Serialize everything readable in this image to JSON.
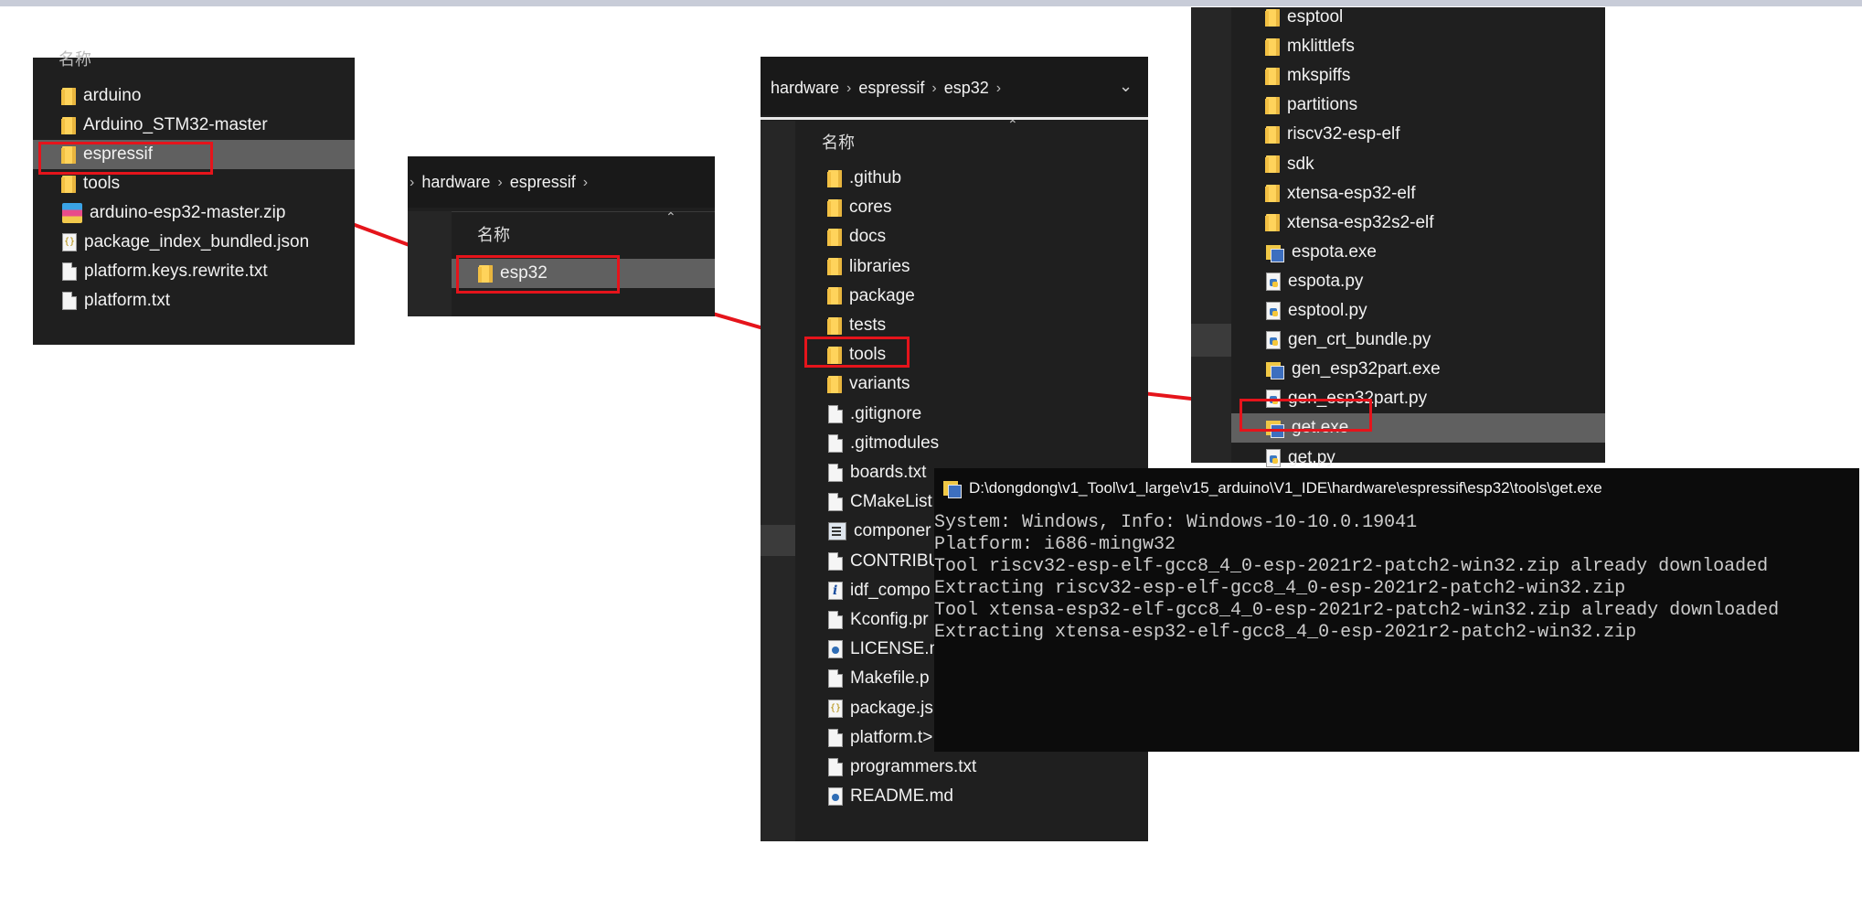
{
  "panel1": {
    "header": "名称",
    "items": [
      {
        "icon": "folder",
        "label": "arduino"
      },
      {
        "icon": "folder",
        "label": "Arduino_STM32-master"
      },
      {
        "icon": "folder",
        "label": "espressif"
      },
      {
        "icon": "folder",
        "label": "tools"
      },
      {
        "icon": "zip",
        "label": "arduino-esp32-master.zip"
      },
      {
        "icon": "json",
        "label": "package_index_bundled.json"
      },
      {
        "icon": "file",
        "label": "platform.keys.rewrite.txt"
      },
      {
        "icon": "file",
        "label": "platform.txt"
      }
    ]
  },
  "panel2": {
    "breadcrumb": [
      "hardware",
      "espressif"
    ],
    "header": "名称",
    "items": [
      {
        "icon": "folder",
        "label": "esp32"
      }
    ]
  },
  "panel3": {
    "breadcrumb": [
      "hardware",
      "espressif",
      "esp32"
    ],
    "header": "名称",
    "items": [
      {
        "icon": "folder",
        "label": ".github"
      },
      {
        "icon": "folder",
        "label": "cores"
      },
      {
        "icon": "folder",
        "label": "docs"
      },
      {
        "icon": "folder",
        "label": "libraries"
      },
      {
        "icon": "folder",
        "label": "package"
      },
      {
        "icon": "folder",
        "label": "tests"
      },
      {
        "icon": "folder",
        "label": "tools"
      },
      {
        "icon": "folder",
        "label": "variants"
      },
      {
        "icon": "file",
        "label": ".gitignore"
      },
      {
        "icon": "file",
        "label": ".gitmodules"
      },
      {
        "icon": "file",
        "label": "boards.txt"
      },
      {
        "icon": "file",
        "label": "CMakeList"
      },
      {
        "icon": "cmd",
        "label": "componer"
      },
      {
        "icon": "file",
        "label": "CONTRIBU"
      },
      {
        "icon": "info",
        "label": "idf_compo"
      },
      {
        "icon": "file",
        "label": "Kconfig.pr"
      },
      {
        "icon": "md",
        "label": "LICENSE.m"
      },
      {
        "icon": "file",
        "label": "Makefile.p"
      },
      {
        "icon": "json",
        "label": "package.js"
      },
      {
        "icon": "file",
        "label": "platform.t>"
      },
      {
        "icon": "file",
        "label": "programmers.txt"
      },
      {
        "icon": "md",
        "label": "README.md"
      }
    ]
  },
  "panel4": {
    "items": [
      {
        "icon": "folder",
        "label": "esptool"
      },
      {
        "icon": "folder",
        "label": "mklittlefs"
      },
      {
        "icon": "folder",
        "label": "mkspiffs"
      },
      {
        "icon": "folder",
        "label": "partitions"
      },
      {
        "icon": "folder",
        "label": "riscv32-esp-elf"
      },
      {
        "icon": "folder",
        "label": "sdk"
      },
      {
        "icon": "folder",
        "label": "xtensa-esp32-elf"
      },
      {
        "icon": "folder",
        "label": "xtensa-esp32s2-elf"
      },
      {
        "icon": "exe",
        "label": "espota.exe"
      },
      {
        "icon": "py",
        "label": "espota.py"
      },
      {
        "icon": "py",
        "label": "esptool.py"
      },
      {
        "icon": "py",
        "label": "gen_crt_bundle.py"
      },
      {
        "icon": "exe",
        "label": "gen_esp32part.exe"
      },
      {
        "icon": "py",
        "label": "gen_esp32part.py"
      },
      {
        "icon": "exe",
        "label": "get.exe"
      },
      {
        "icon": "py",
        "label": "get.py"
      }
    ]
  },
  "terminal": {
    "title": "D:\\dongdong\\v1_Tool\\v1_large\\v15_arduino\\V1_IDE\\hardware\\espressif\\esp32\\tools\\get.exe",
    "lines": [
      "System: Windows, Info: Windows-10-10.0.19041",
      "Platform: i686-mingw32",
      "Tool riscv32-esp-elf-gcc8_4_0-esp-2021r2-patch2-win32.zip already downloaded",
      "Extracting riscv32-esp-elf-gcc8_4_0-esp-2021r2-patch2-win32.zip",
      "Tool xtensa-esp32-elf-gcc8_4_0-esp-2021r2-patch2-win32.zip already downloaded",
      "Extracting xtensa-esp32-elf-gcc8_4_0-esp-2021r2-patch2-win32.zip"
    ]
  },
  "colors": {
    "highlight": "#e5141b",
    "panel_bg": "#1f1f1f",
    "terminal_bg": "#0c0c0c",
    "selection": "#606060"
  }
}
